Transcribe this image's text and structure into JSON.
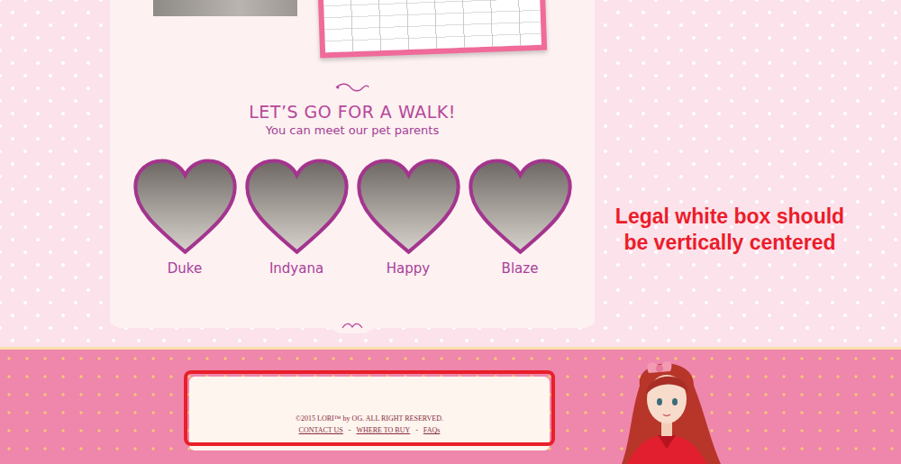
{
  "section": {
    "title": "LET’S GO FOR A WALK!",
    "subtitle": "You can meet our pet parents"
  },
  "pets": [
    {
      "name": "Duke"
    },
    {
      "name": "Indyana"
    },
    {
      "name": "Happy"
    },
    {
      "name": "Blaze"
    }
  ],
  "footer": {
    "copyright": "©2015 LORI™ by OG. ALL RIGHT RESERVED.",
    "links": [
      "CONTACT US",
      "WHERE TO BUY",
      "FAQs"
    ],
    "separator": "-"
  },
  "annotation": {
    "text": "Legal white box should be vertically centered"
  }
}
